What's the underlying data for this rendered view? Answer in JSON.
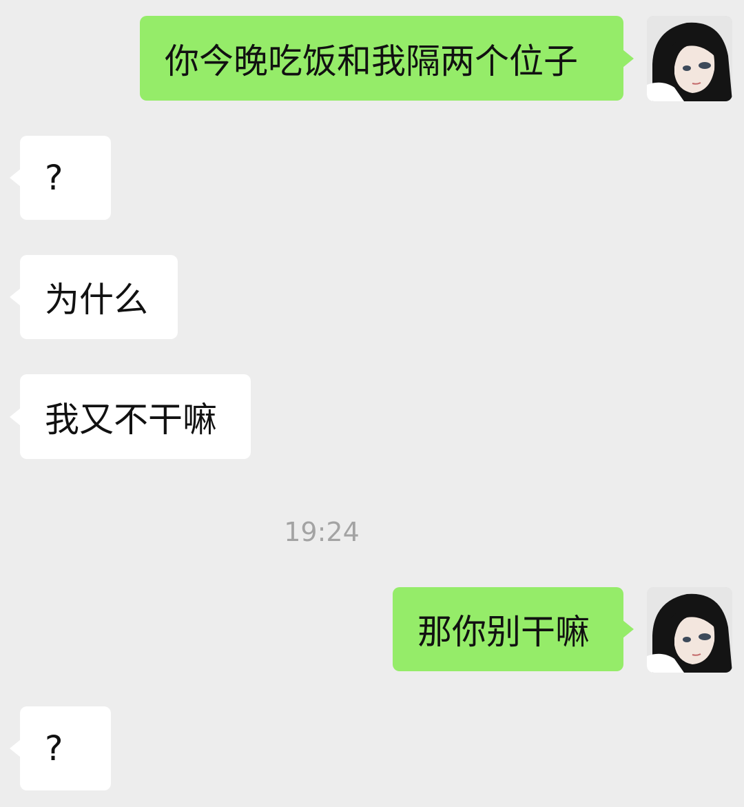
{
  "colors": {
    "background": "#ededed",
    "my_bubble": "#95ec69",
    "their_bubble": "#ffffff",
    "timestamp_text": "#a3a3a3"
  },
  "messages": [
    {
      "sender": "me",
      "text": "你今晚吃饭和我隔两个位子"
    },
    {
      "sender": "other",
      "text": "?"
    },
    {
      "sender": "other",
      "text": "为什么"
    },
    {
      "sender": "other",
      "text": "我又不干嘛"
    },
    {
      "sender": "me",
      "text": "那你别干嘛"
    },
    {
      "sender": "other",
      "text": "?"
    }
  ],
  "timestamp": "19:24",
  "avatar": {
    "icon": "anime-girl-avatar-icon"
  }
}
